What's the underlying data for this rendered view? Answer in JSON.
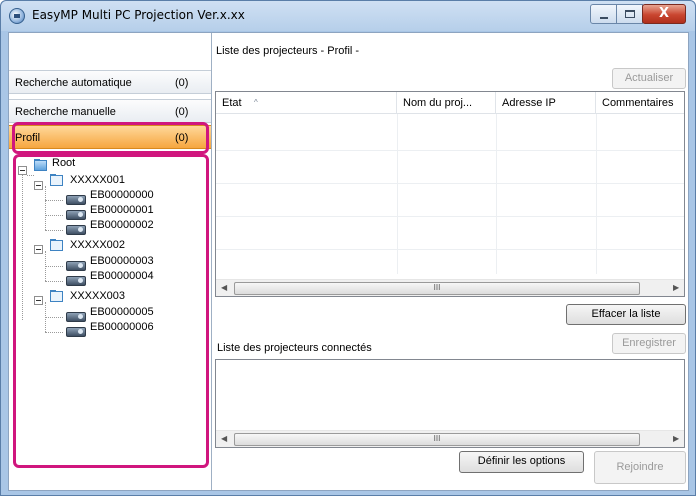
{
  "window": {
    "title": "EasyMP Multi PC Projection Ver.x.xx",
    "close_glyph": "X"
  },
  "sidebar": {
    "items": [
      {
        "label": "Recherche automatique",
        "count": "(0)"
      },
      {
        "label": "Recherche manuelle",
        "count": "(0)"
      },
      {
        "label": "Profil",
        "count": "(0)",
        "selected": true
      }
    ],
    "highlight_color": "#d0167e",
    "selected_color": "#f6a640"
  },
  "tree": {
    "root": "Root",
    "groups": [
      {
        "name": "XXXXX001",
        "projectors": [
          "EB00000000",
          "EB00000001",
          "EB00000002"
        ]
      },
      {
        "name": "XXXXX002",
        "projectors": [
          "EB00000003",
          "EB00000004"
        ]
      },
      {
        "name": "XXXXX003",
        "projectors": [
          "EB00000005",
          "EB00000006"
        ]
      }
    ]
  },
  "main": {
    "projector_list_title": "Liste des projecteurs - Profil -",
    "refresh_button": "Actualiser",
    "columns": [
      "Etat",
      "Nom du proj...",
      "Adresse IP",
      "Commentaires"
    ],
    "sort_indicator": "^",
    "scroll_thumb_glyph": "III",
    "clear_list_button": "Effacer la liste",
    "connected_list_title": "Liste des projecteurs connectés",
    "save_button": "Enregistrer",
    "options_button": "Définir les options",
    "join_button": "Rejoindre"
  },
  "icons": {
    "app": "projector-app-icon",
    "minimize": "minimize-icon",
    "maximize": "maximize-icon",
    "close": "close-icon",
    "folder": "folder-icon",
    "projector": "projector-icon",
    "expander": "tree-collapse-icon"
  }
}
